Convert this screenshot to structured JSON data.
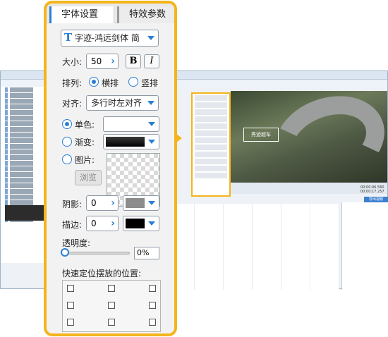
{
  "tabs": {
    "font": "字体设置",
    "effects": "特效参数"
  },
  "font": {
    "name": "字迹-鸿远剑体 简"
  },
  "size": {
    "label": "大小:",
    "value": "50",
    "bold_label": "B",
    "italic_label": "I"
  },
  "layout": {
    "label": "排列:",
    "horizontal": "横排",
    "vertical": "竖排",
    "selected": "horizontal"
  },
  "align": {
    "label": "对齐:",
    "value": "多行时左对齐"
  },
  "fill": {
    "solid_label": "单色:",
    "gradient_label": "渐变:",
    "image_label": "图片:",
    "selected": "solid",
    "solid_color": "#ffffff",
    "gradient_color": "#1a1a1a",
    "browse_label": "浏览"
  },
  "shadow": {
    "label": "阴影:",
    "value": "0",
    "color": "#8c8c8c"
  },
  "stroke": {
    "label": "描边:",
    "value": "0",
    "color": "#000000"
  },
  "opacity": {
    "label": "透明度:",
    "value": "0%"
  },
  "position": {
    "label": "快速定位摆放的位置:"
  },
  "background_app": {
    "video_caption": "秀迹超车",
    "time_current": "00:00:06.560",
    "time_total": "00:00:17.257",
    "export_label": "导出视频",
    "accent": "#f3b51b",
    "tab_accent": "#2a7fd4"
  }
}
